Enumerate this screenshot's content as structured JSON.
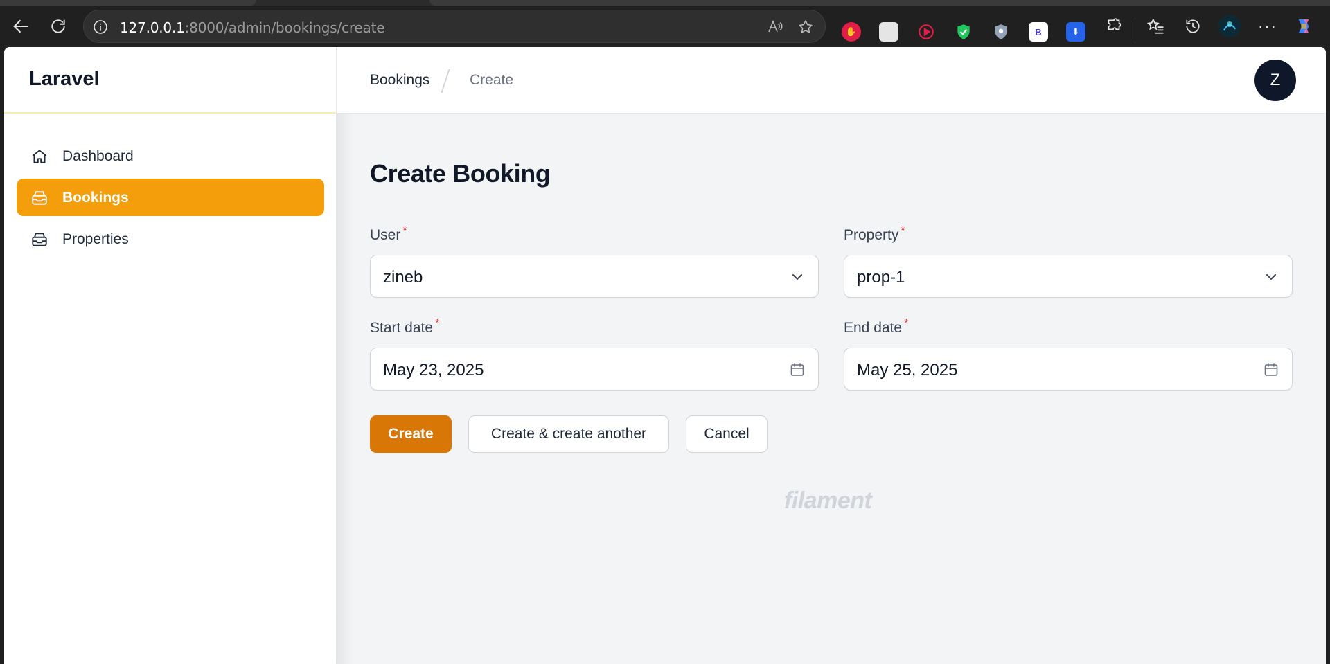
{
  "browser": {
    "url_host": "127.0.0.1",
    "url_path": ":8000/admin/bookings/create"
  },
  "sidebar": {
    "brand": "Laravel",
    "items": [
      {
        "label": "Dashboard",
        "icon": "home-icon",
        "active": false
      },
      {
        "label": "Bookings",
        "icon": "inbox-stack-icon",
        "active": true
      },
      {
        "label": "Properties",
        "icon": "inbox-stack-icon",
        "active": false
      }
    ]
  },
  "topbar": {
    "breadcrumbs": [
      "Bookings",
      "Create"
    ],
    "avatar_initial": "Z"
  },
  "page": {
    "title": "Create Booking",
    "fields": {
      "user": {
        "label": "User",
        "required": "*",
        "value": "zineb"
      },
      "property": {
        "label": "Property",
        "required": "*",
        "value": "prop-1"
      },
      "start_date": {
        "label": "Start date",
        "required": "*",
        "value": "May 23, 2025"
      },
      "end_date": {
        "label": "End date",
        "required": "*",
        "value": "May 25, 2025"
      }
    },
    "buttons": {
      "create": "Create",
      "create_another": "Create & create another",
      "cancel": "Cancel"
    },
    "footer": "filament"
  },
  "colors": {
    "primary": "#f59e0b",
    "primary_button": "#d97706",
    "required": "#dc2626"
  }
}
